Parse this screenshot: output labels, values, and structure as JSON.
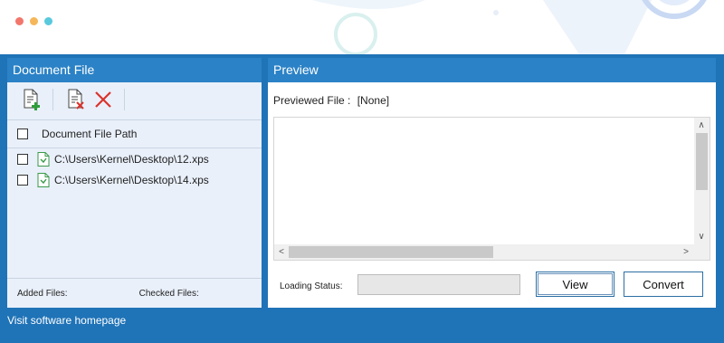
{
  "window": {
    "dots": [
      {
        "name": "close",
        "color": "#f2766c"
      },
      {
        "name": "minimize",
        "color": "#f5b75a"
      },
      {
        "name": "maximize",
        "color": "#59c9dd"
      }
    ]
  },
  "colors": {
    "frame": "#1f73b7",
    "header": "#2b82c6",
    "left_panel_bg": "#e9f0fa"
  },
  "document_panel": {
    "title": "Document File",
    "toolbar": [
      {
        "icon": "add-file-icon"
      },
      {
        "icon": "remove-file-icon"
      },
      {
        "icon": "remove-all-icon"
      }
    ],
    "column_header": "Document File Path",
    "files": [
      {
        "path": "C:\\Users\\Kernel\\Desktop\\12.xps",
        "checked": false
      },
      {
        "path": "C:\\Users\\Kernel\\Desktop\\14.xps",
        "checked": false
      }
    ],
    "added_files_label": "Added Files:",
    "checked_files_label": "Checked Files:"
  },
  "preview_panel": {
    "title": "Preview",
    "previewed_file_label": "Previewed File :",
    "previewed_file_value": "[None]",
    "loading_status_label": "Loading Status:",
    "view_button": "View",
    "convert_button": "Convert"
  },
  "footer": {
    "link_text": "Visit software homepage"
  }
}
